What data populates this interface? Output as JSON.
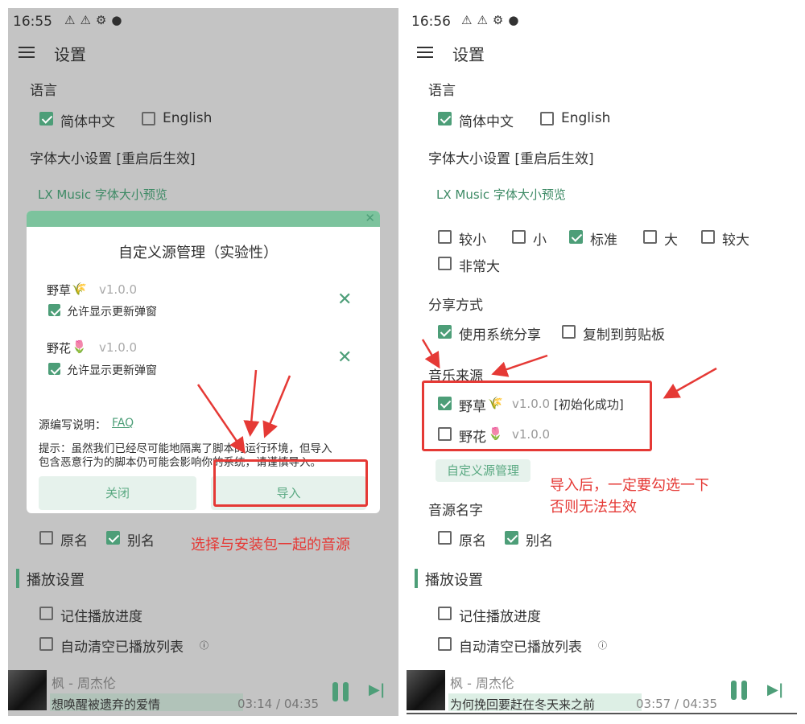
{
  "left": {
    "status": {
      "time": "16:55"
    },
    "header": {
      "title": "设置"
    },
    "language": {
      "label": "语言",
      "options": [
        {
          "label": "简体中文",
          "checked": true
        },
        {
          "label": "English",
          "checked": false
        }
      ]
    },
    "font_size": {
      "label": "字体大小设置 [重启后生效]",
      "preview": "LX Music 字体大小预览"
    },
    "dialog": {
      "title": "自定义源管理（实验性）",
      "sources": [
        {
          "name": "野草",
          "emoji": "🌾",
          "version": "v1.0.0",
          "allow_update": "允许显示更新弹窗",
          "checked": true
        },
        {
          "name": "野花",
          "emoji": "🌷",
          "version": "v1.0.0",
          "allow_update": "允许显示更新弹窗",
          "checked": true
        }
      ],
      "faq_label": "源编写说明：",
      "faq_link": "FAQ",
      "hint_line1": "提示：虽然我们已经尽可能地隔离了脚本的运行环境，但导入",
      "hint_line2": "包含恶意行为的脚本仍可能会影响你的系统，请谨慎导入。",
      "close": "关闭",
      "import": "导入"
    },
    "source_name": {
      "options": [
        {
          "label": "原名",
          "checked": false
        },
        {
          "label": "别名",
          "checked": true
        }
      ]
    },
    "annotation": "选择与安装包一起的音源",
    "play": {
      "label": "播放设置",
      "remember": "记住播放进度",
      "auto_clear": "自动清空已播放列表"
    },
    "player": {
      "title": "枫 - 周杰伦",
      "lyric": "想唤醒被遗弃的爱情",
      "time": "03:14 / 04:35"
    }
  },
  "right": {
    "status": {
      "time": "16:56"
    },
    "header": {
      "title": "设置"
    },
    "language": {
      "label": "语言",
      "options": [
        {
          "label": "简体中文",
          "checked": true
        },
        {
          "label": "English",
          "checked": false
        }
      ]
    },
    "font_size": {
      "label": "字体大小设置 [重启后生效]",
      "preview": "LX Music 字体大小预览",
      "options": [
        {
          "label": "较小",
          "checked": false
        },
        {
          "label": "小",
          "checked": false
        },
        {
          "label": "标准",
          "checked": true
        },
        {
          "label": "大",
          "checked": false
        },
        {
          "label": "较大",
          "checked": false
        },
        {
          "label": "非常大",
          "checked": false
        }
      ]
    },
    "share": {
      "label": "分享方式",
      "options": [
        {
          "label": "使用系统分享",
          "checked": true
        },
        {
          "label": "复制到剪贴板",
          "checked": false
        }
      ]
    },
    "music_source": {
      "label": "音乐来源",
      "sources": [
        {
          "name": "野草",
          "emoji": "🌾",
          "version": "v1.0.0",
          "status": "[初始化成功]",
          "checked": true
        },
        {
          "name": "野花",
          "emoji": "🌷",
          "version": "v1.0.0",
          "checked": false
        }
      ],
      "manage": "自定义源管理"
    },
    "annotation_line1": "导入后，一定要勾选一下",
    "annotation_line2": "否则无法生效",
    "source_name": {
      "label": "音源名字",
      "options": [
        {
          "label": "原名",
          "checked": false
        },
        {
          "label": "别名",
          "checked": true
        }
      ]
    },
    "play": {
      "label": "播放设置",
      "remember": "记住播放进度",
      "auto_clear": "自动清空已播放列表"
    },
    "player": {
      "title": "枫 - 周杰伦",
      "lyric": "为何挽回要赶在冬天来之前",
      "time": "03:57 / 04:35"
    }
  },
  "colors": {
    "accent": "#4d9e78",
    "annotation": "#e53935"
  }
}
